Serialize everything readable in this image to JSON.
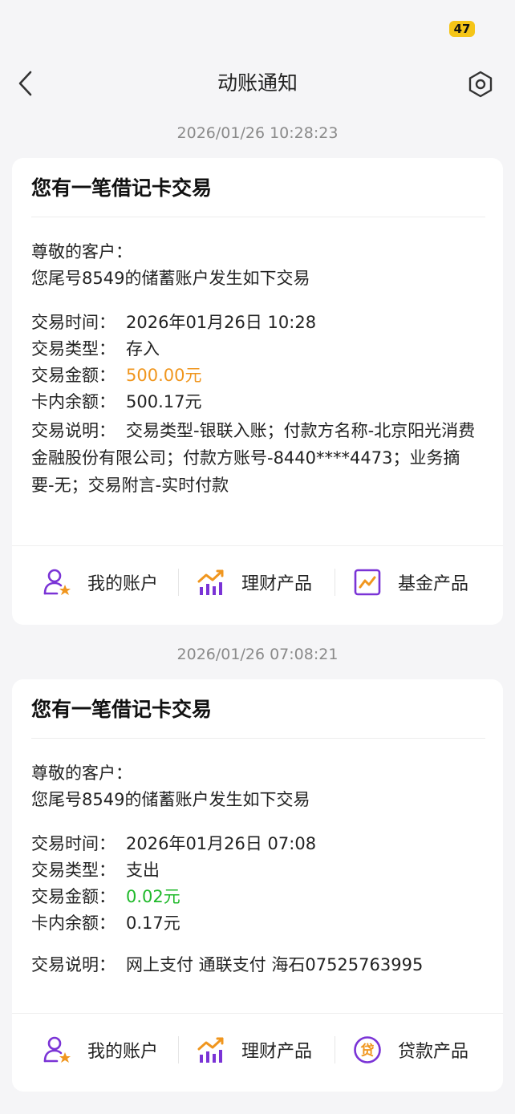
{
  "status": {
    "battery": "47"
  },
  "nav": {
    "title": "动账通知",
    "back_icon": "chevron-left-icon",
    "settings_icon": "hexagon-settings-icon"
  },
  "messages": [
    {
      "timestamp": "2026/01/26 10:28:23",
      "title": "您有一笔借记卡交易",
      "greeting": "尊敬的客户：",
      "intro": "您尾号8549的储蓄账户发生如下交易",
      "fields": [
        {
          "label": "交易时间：",
          "value": "2026年01月26日  10:28"
        },
        {
          "label": "交易类型：",
          "value": "存入"
        },
        {
          "label": "交易金额：",
          "value": "500.00元",
          "color": "#f0961e"
        },
        {
          "label": "卡内余额：",
          "value": "500.17元"
        }
      ],
      "description_label": "交易说明：",
      "description": "交易类型-银联入账；付款方名称-北京阳光消费金融股份有限公司；付款方账号-8440****4473；业务摘要-无；交易附言-实时付款",
      "actions": [
        {
          "label": "我的账户",
          "icon": "account-icon"
        },
        {
          "label": "理财产品",
          "icon": "wealth-chart-icon"
        },
        {
          "label": "基金产品",
          "icon": "fund-chart-icon"
        }
      ]
    },
    {
      "timestamp": "2026/01/26 07:08:21",
      "title": "您有一笔借记卡交易",
      "greeting": "尊敬的客户：",
      "intro": "您尾号8549的储蓄账户发生如下交易",
      "fields": [
        {
          "label": "交易时间：",
          "value": "2026年01月26日  07:08"
        },
        {
          "label": "交易类型：",
          "value": "支出"
        },
        {
          "label": "交易金额：",
          "value": "0.02元",
          "color": "#1fb92a"
        },
        {
          "label": "卡内余额：",
          "value": "0.17元"
        }
      ],
      "description_label": "交易说明：",
      "description": "网上支付 通联支付 海石07525763995",
      "actions": [
        {
          "label": "我的账户",
          "icon": "account-icon"
        },
        {
          "label": "理财产品",
          "icon": "wealth-chart-icon"
        },
        {
          "label": "贷款产品",
          "icon": "loan-icon",
          "glyph": "贷"
        }
      ]
    }
  ],
  "colors": {
    "accent_purple": "#7a33d6",
    "accent_orange": "#f0961e",
    "income_orange": "#f0961e",
    "expense_green": "#1fb92a"
  }
}
